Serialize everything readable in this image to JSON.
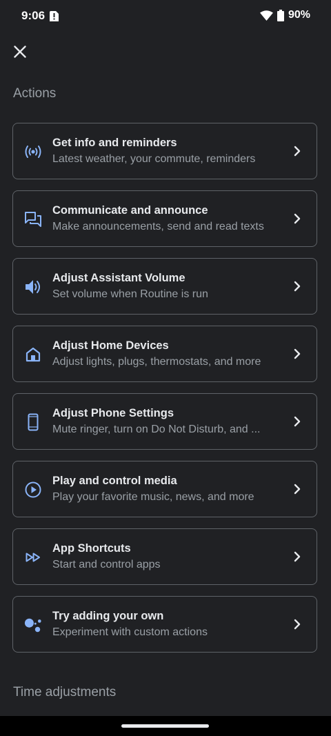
{
  "status": {
    "time": "9:06",
    "battery": "90%"
  },
  "header": {
    "close_icon": "close-icon"
  },
  "sections": {
    "actions_title": "Actions",
    "time_title": "Time adjustments"
  },
  "colors": {
    "accent": "#8ab4f8",
    "background": "#202124",
    "border": "#5f6368"
  },
  "actions": [
    {
      "title": "Get info and reminders",
      "subtitle": "Latest weather, your commute, reminders",
      "icon": "broadcast-icon"
    },
    {
      "title": "Communicate and announce",
      "subtitle": "Make announcements, send and read texts",
      "icon": "chat-icon"
    },
    {
      "title": "Adjust Assistant Volume",
      "subtitle": "Set volume when Routine is run",
      "icon": "volume-icon"
    },
    {
      "title": "Adjust Home Devices",
      "subtitle": "Adjust lights, plugs, thermostats, and more",
      "icon": "home-icon"
    },
    {
      "title": "Adjust Phone Settings",
      "subtitle": "Mute ringer, turn on Do Not Disturb, and ...",
      "icon": "phone-icon"
    },
    {
      "title": "Play and control media",
      "subtitle": "Play your favorite music, news, and more",
      "icon": "play-icon"
    },
    {
      "title": "App Shortcuts",
      "subtitle": "Start and control apps",
      "icon": "fast-forward-icon"
    },
    {
      "title": "Try adding your own",
      "subtitle": "Experiment with custom actions",
      "icon": "assistant-dots-icon"
    }
  ]
}
